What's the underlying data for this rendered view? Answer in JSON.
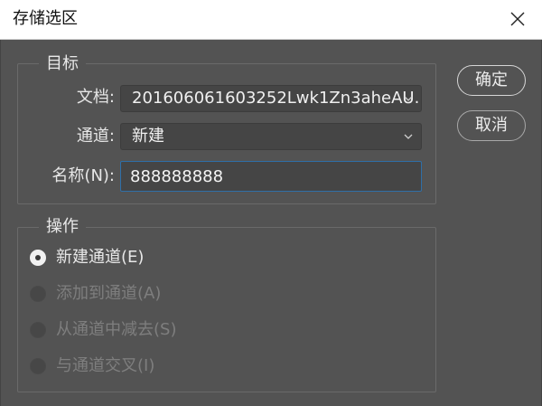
{
  "dialog": {
    "title": "存储选区"
  },
  "target_group": {
    "legend": "目标",
    "document_label": "文档:",
    "document_value": "20160606160325​2Lwk1Zn3aheAU...",
    "channel_label": "通道:",
    "channel_value": "新建",
    "name_label": "名称(N):",
    "name_value": "888888888"
  },
  "buttons": {
    "ok": "确定",
    "cancel": "取消"
  },
  "operation_group": {
    "legend": "操作",
    "options": [
      {
        "label": "新建通道(E)",
        "selected": true,
        "enabled": true
      },
      {
        "label": "添加到通道(A)",
        "selected": false,
        "enabled": false
      },
      {
        "label": "从通道中减去(S)",
        "selected": false,
        "enabled": false
      },
      {
        "label": "与通道交叉(I)",
        "selected": false,
        "enabled": false
      }
    ]
  },
  "icons": {
    "close": "close-icon",
    "dropdown": "chevron-down-icon"
  },
  "colors": {
    "panel_bg": "#535353",
    "field_bg": "#454545",
    "focus_border": "#2f6fa8",
    "titlebar_bg": "#ffffff"
  }
}
